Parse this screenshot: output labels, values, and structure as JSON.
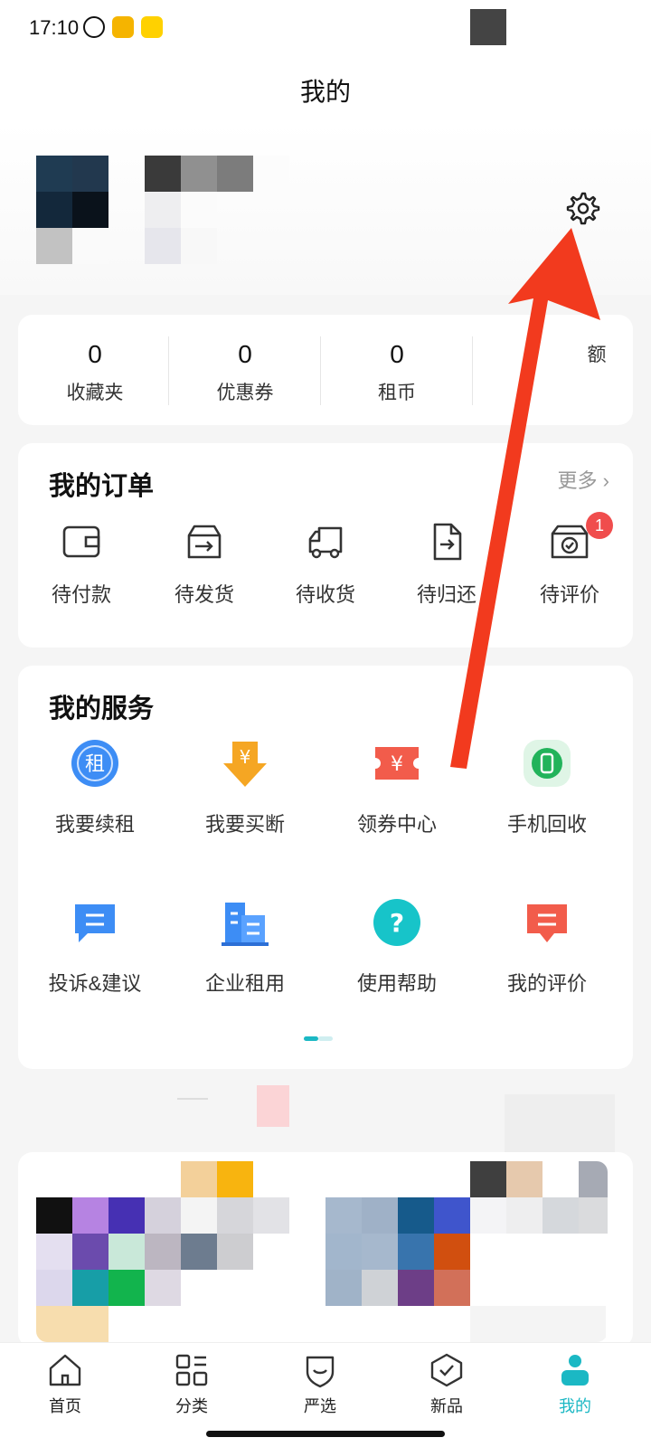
{
  "status_bar": {
    "time": "17:10",
    "icons": [
      "alarm-icon",
      "weibo-icon",
      "meituan-icon"
    ]
  },
  "header": {
    "title": "我的"
  },
  "profile": {
    "settings_icon": "gear-icon"
  },
  "stats": [
    {
      "value": "0",
      "label": "收藏夹"
    },
    {
      "value": "0",
      "label": "优惠券"
    },
    {
      "value": "0",
      "label": "租币"
    },
    {
      "value": "",
      "label": "额"
    }
  ],
  "orders": {
    "title": "我的订单",
    "more": "更多",
    "items": [
      {
        "label": "待付款",
        "icon": "wallet-icon"
      },
      {
        "label": "待发货",
        "icon": "package-icon"
      },
      {
        "label": "待收货",
        "icon": "truck-icon"
      },
      {
        "label": "待归还",
        "icon": "return-icon"
      },
      {
        "label": "待评价",
        "icon": "review-box-icon",
        "badge": "1"
      }
    ]
  },
  "services": {
    "title": "我的服务",
    "items": [
      {
        "label": "我要续租",
        "icon": "renew-icon",
        "glyph": "租"
      },
      {
        "label": "我要买断",
        "icon": "buyout-icon",
        "glyph": "¥"
      },
      {
        "label": "领券中心",
        "icon": "coupon-icon",
        "glyph": "¥"
      },
      {
        "label": "手机回收",
        "icon": "recycle-phone-icon"
      },
      {
        "label": "投诉&建议",
        "icon": "complaint-icon"
      },
      {
        "label": "企业租用",
        "icon": "enterprise-icon"
      },
      {
        "label": "使用帮助",
        "icon": "help-icon",
        "glyph": "?"
      },
      {
        "label": "我的评价",
        "icon": "my-review-icon"
      }
    ]
  },
  "tabs": [
    {
      "label": "首页",
      "icon": "home-icon"
    },
    {
      "label": "分类",
      "icon": "category-icon"
    },
    {
      "label": "严选",
      "icon": "shield-icon"
    },
    {
      "label": "新品",
      "icon": "new-badge-icon"
    },
    {
      "label": "我的",
      "icon": "profile-icon",
      "active": true
    }
  ],
  "colors": {
    "accent": "#1bb8c4",
    "annotation": "#f23a1e",
    "badge": "#f04d4d"
  }
}
